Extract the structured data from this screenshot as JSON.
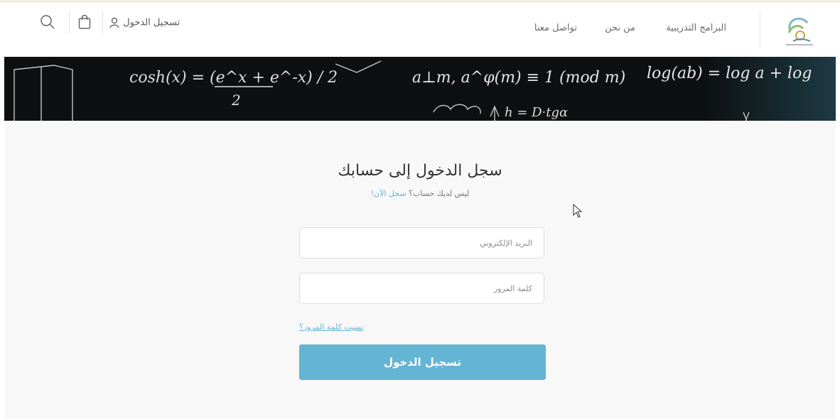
{
  "header": {
    "nav": [
      {
        "label": "البرامج التدريبية"
      },
      {
        "label": "من نحن"
      },
      {
        "label": "تواصل معنا"
      }
    ],
    "login_label": "تسجيل الدخول",
    "icons": {
      "search": "search-icon",
      "cart": "shopping-bag-icon",
      "user": "user-icon",
      "logo": "logo"
    }
  },
  "banner": {
    "formulas": [
      "cosh(x) = (e^x + e^-x) / 2",
      "a⊥m, a^φ(m) ≡ 1 (mod m)",
      "log(ab) = log a + log",
      "h = D·tgα"
    ]
  },
  "login": {
    "title": "سجل الدخول إلى حسابك",
    "subtitle_text": "ليس لديك حساب؟",
    "register_link": "سجل الآن!",
    "email_placeholder": "البريد الإلكتروني",
    "password_placeholder": "كلمة المرور",
    "forgot_link": "نسيت كلمة المرور؟",
    "submit_label": "تسجيل الدخول"
  },
  "colors": {
    "accent": "#64b4d4",
    "background": "#f8f8f8",
    "banner": "#0d0f10"
  }
}
